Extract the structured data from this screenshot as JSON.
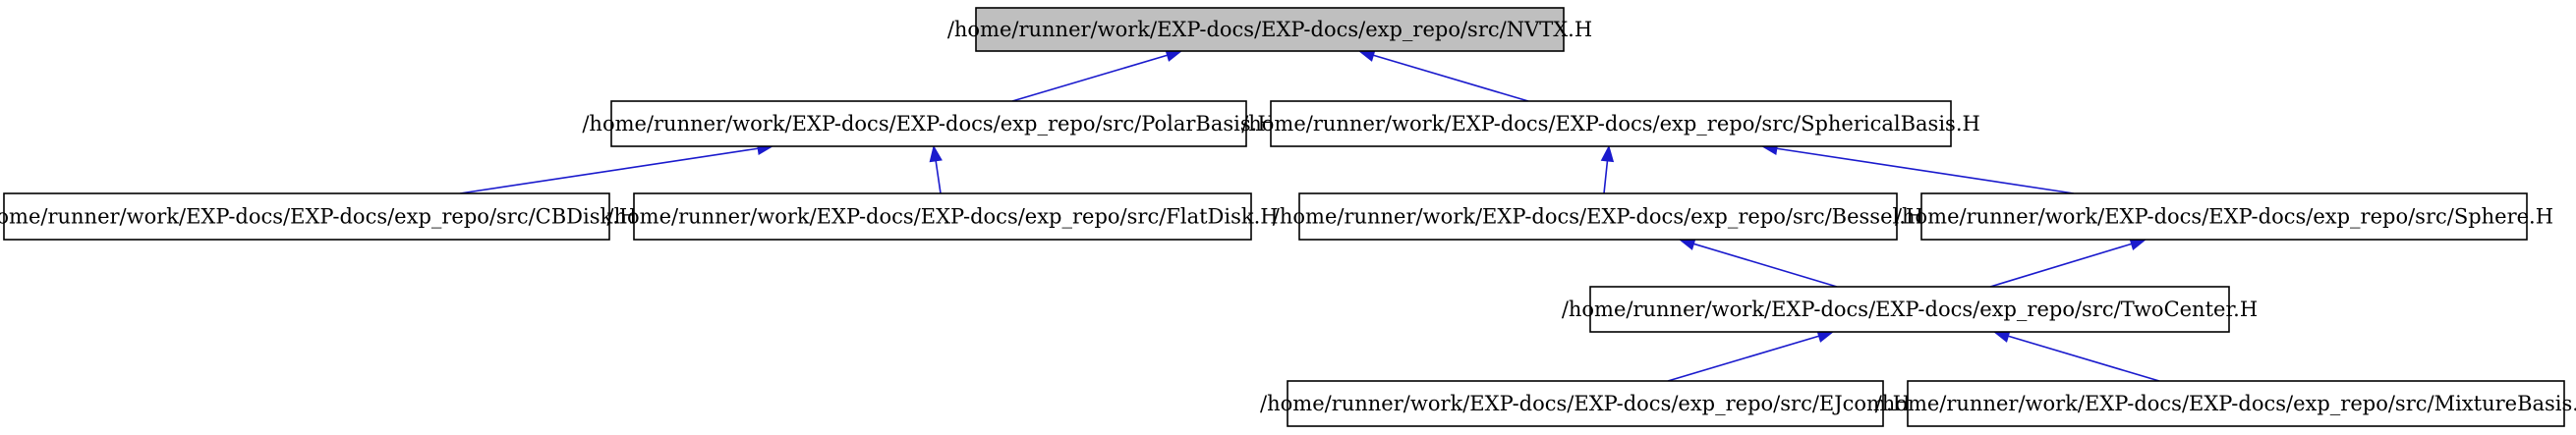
{
  "graph": {
    "nodes": [
      {
        "id": "nvtx",
        "label": "/home/runner/work/EXP-docs/EXP-docs/exp_repo/src/NVTX.H",
        "root": true
      },
      {
        "id": "polar",
        "label": "/home/runner/work/EXP-docs/EXP-docs/exp_repo/src/PolarBasis.H",
        "root": false
      },
      {
        "id": "spherical",
        "label": "/home/runner/work/EXP-docs/EXP-docs/exp_repo/src/SphericalBasis.H",
        "root": false
      },
      {
        "id": "cbdisk",
        "label": "/home/runner/work/EXP-docs/EXP-docs/exp_repo/src/CBDisk.H",
        "root": false
      },
      {
        "id": "flatdisk",
        "label": "/home/runner/work/EXP-docs/EXP-docs/exp_repo/src/FlatDisk.H",
        "root": false
      },
      {
        "id": "bessel",
        "label": "/home/runner/work/EXP-docs/EXP-docs/exp_repo/src/Bessel.H",
        "root": false
      },
      {
        "id": "sphere",
        "label": "/home/runner/work/EXP-docs/EXP-docs/exp_repo/src/Sphere.H",
        "root": false
      },
      {
        "id": "twocenter",
        "label": "/home/runner/work/EXP-docs/EXP-docs/exp_repo/src/TwoCenter.H",
        "root": false
      },
      {
        "id": "ejcom",
        "label": "/home/runner/work/EXP-docs/EXP-docs/exp_repo/src/EJcom.H",
        "root": false
      },
      {
        "id": "mixture",
        "label": "/home/runner/work/EXP-docs/EXP-docs/exp_repo/src/MixtureBasis.H",
        "root": false
      }
    ],
    "edges": [
      {
        "from": "polar",
        "to": "nvtx"
      },
      {
        "from": "spherical",
        "to": "nvtx"
      },
      {
        "from": "cbdisk",
        "to": "polar"
      },
      {
        "from": "flatdisk",
        "to": "polar"
      },
      {
        "from": "bessel",
        "to": "spherical"
      },
      {
        "from": "sphere",
        "to": "spherical"
      },
      {
        "from": "twocenter",
        "to": "bessel"
      },
      {
        "from": "twocenter",
        "to": "sphere"
      },
      {
        "from": "ejcom",
        "to": "twocenter"
      },
      {
        "from": "mixture",
        "to": "twocenter"
      }
    ]
  }
}
